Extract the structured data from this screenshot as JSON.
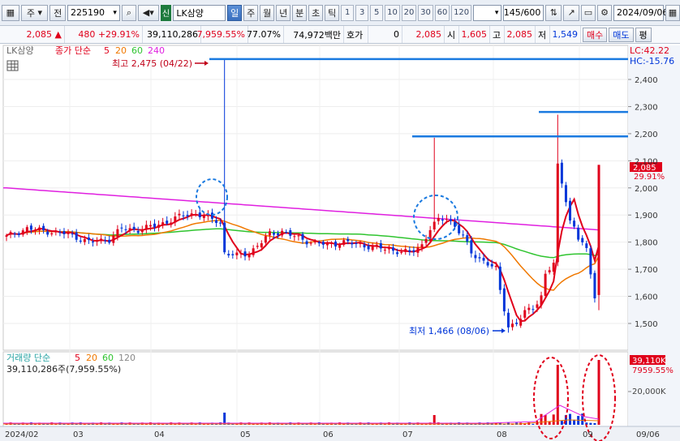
{
  "toolbar": {
    "market": "주",
    "jeon": "전",
    "code": "225190",
    "badge": "신",
    "stock_name": "LK삼양",
    "periods": [
      "일",
      "주",
      "월",
      "년",
      "분",
      "초",
      "틱"
    ],
    "selected_period": "일",
    "intervals": [
      "1",
      "3",
      "5",
      "10",
      "20",
      "30",
      "60",
      "120"
    ],
    "count": "145/600",
    "date": "2024/09/06"
  },
  "quote": {
    "price": "2,085",
    "change": "480",
    "change_pct": "+29.91%",
    "volume": "39,110,286",
    "volume_pct": "7,959.55%",
    "turnover_pct": "77.07%",
    "amount": "74,972백만",
    "hoga_label": "호가",
    "hoga_value": "0",
    "current": "2,085",
    "open_label": "시",
    "open": "1,605",
    "high_label": "고",
    "high": "2,085",
    "low_label": "저",
    "low": "1,549",
    "buy_button": "매수",
    "sell_button": "매도",
    "eval_button": "평"
  },
  "price_panel": {
    "stock_label": "LK삼양",
    "indicator_label": "종가 단순",
    "ma_periods": [
      "5",
      "20",
      "60",
      "240"
    ],
    "max_annotation": "최고 2,475 (04/22)",
    "min_annotation": "최저 1,466 (08/06)",
    "lc_label": "LC:42.22",
    "hc_label": "HC:-15.76",
    "price_tag": "2,085",
    "pct_tag": "29.91%",
    "y_ticks": [
      "2,400",
      "2,300",
      "2,200",
      "2,100",
      "2,000",
      "1,900",
      "1,800",
      "1,700",
      "1,600",
      "1,500"
    ]
  },
  "volume_panel": {
    "label": "거래량 단순",
    "ma_periods": [
      "5",
      "20",
      "60",
      "120"
    ],
    "value_label": "39,110,286주(7,959.55%)",
    "volume_tag": "39,110K",
    "volume_pct_tag": "7959.55%",
    "y_tick": "20,000K"
  },
  "x_axis": [
    "2024/02",
    "03",
    "04",
    "05",
    "06",
    "07",
    "08",
    "09",
    "09/06"
  ],
  "colors": {
    "up": "#e0001b",
    "down": "#0036d9",
    "ma5": "#e0001b",
    "ma20": "#f07800",
    "ma60": "#2fc42f",
    "ma240": "#e020e0",
    "resistance": "#1a7ae0"
  }
}
